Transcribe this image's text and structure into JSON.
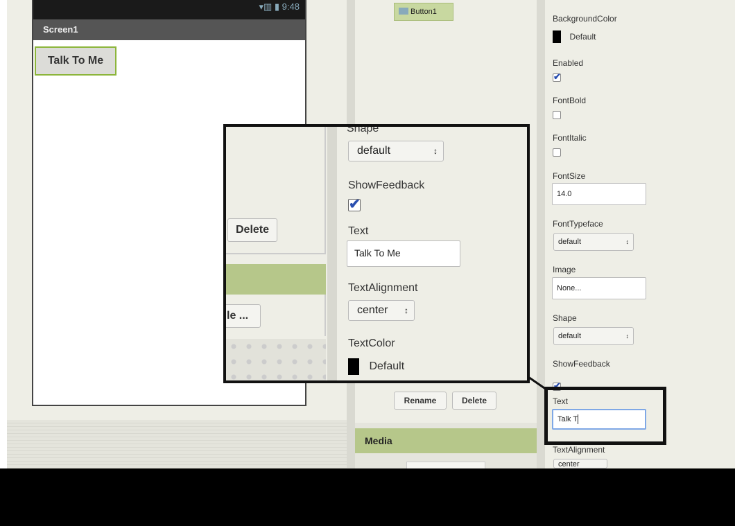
{
  "viewer": {
    "status_icons": "▾▥ ▮ 9:48",
    "screen_title": "Screen1",
    "button_text": "Talk To Me"
  },
  "components": {
    "selected": "Button1",
    "rename_label": "Rename",
    "delete_label": "Delete",
    "media_header": "Media"
  },
  "properties": {
    "background_color": {
      "label": "BackgroundColor",
      "value": "Default",
      "color": "#000000"
    },
    "enabled": {
      "label": "Enabled",
      "checked": true
    },
    "font_bold": {
      "label": "FontBold",
      "checked": false
    },
    "font_italic": {
      "label": "FontItalic",
      "checked": false
    },
    "font_size": {
      "label": "FontSize",
      "value": "14.0"
    },
    "font_typeface": {
      "label": "FontTypeface",
      "value": "default"
    },
    "image": {
      "label": "Image",
      "value": "None..."
    },
    "shape": {
      "label": "Shape",
      "value": "default"
    },
    "show_feedback": {
      "label": "ShowFeedback",
      "checked": true
    },
    "text": {
      "label": "Text",
      "value": "Talk T"
    },
    "text_alignment": {
      "label": "TextAlignment",
      "value": "center"
    }
  },
  "callout": {
    "delete_label": "Delete",
    "ellipsis_label": "le ...",
    "shape_label": "Shape",
    "shape_value": "default",
    "show_feedback_label": "ShowFeedback",
    "text_label": "Text",
    "text_value": "Talk To Me",
    "text_alignment_label": "TextAlignment",
    "text_alignment_value": "center",
    "text_color_label": "TextColor",
    "text_color_value": "Default"
  },
  "colors": {
    "accent_green": "#b6c78a",
    "selection_border": "#8cb53b",
    "check_blue": "#2a4fb0",
    "focus_blue": "#7fa8e6"
  },
  "icons": {
    "select_arrow": "↕",
    "checkmark": "✔"
  }
}
